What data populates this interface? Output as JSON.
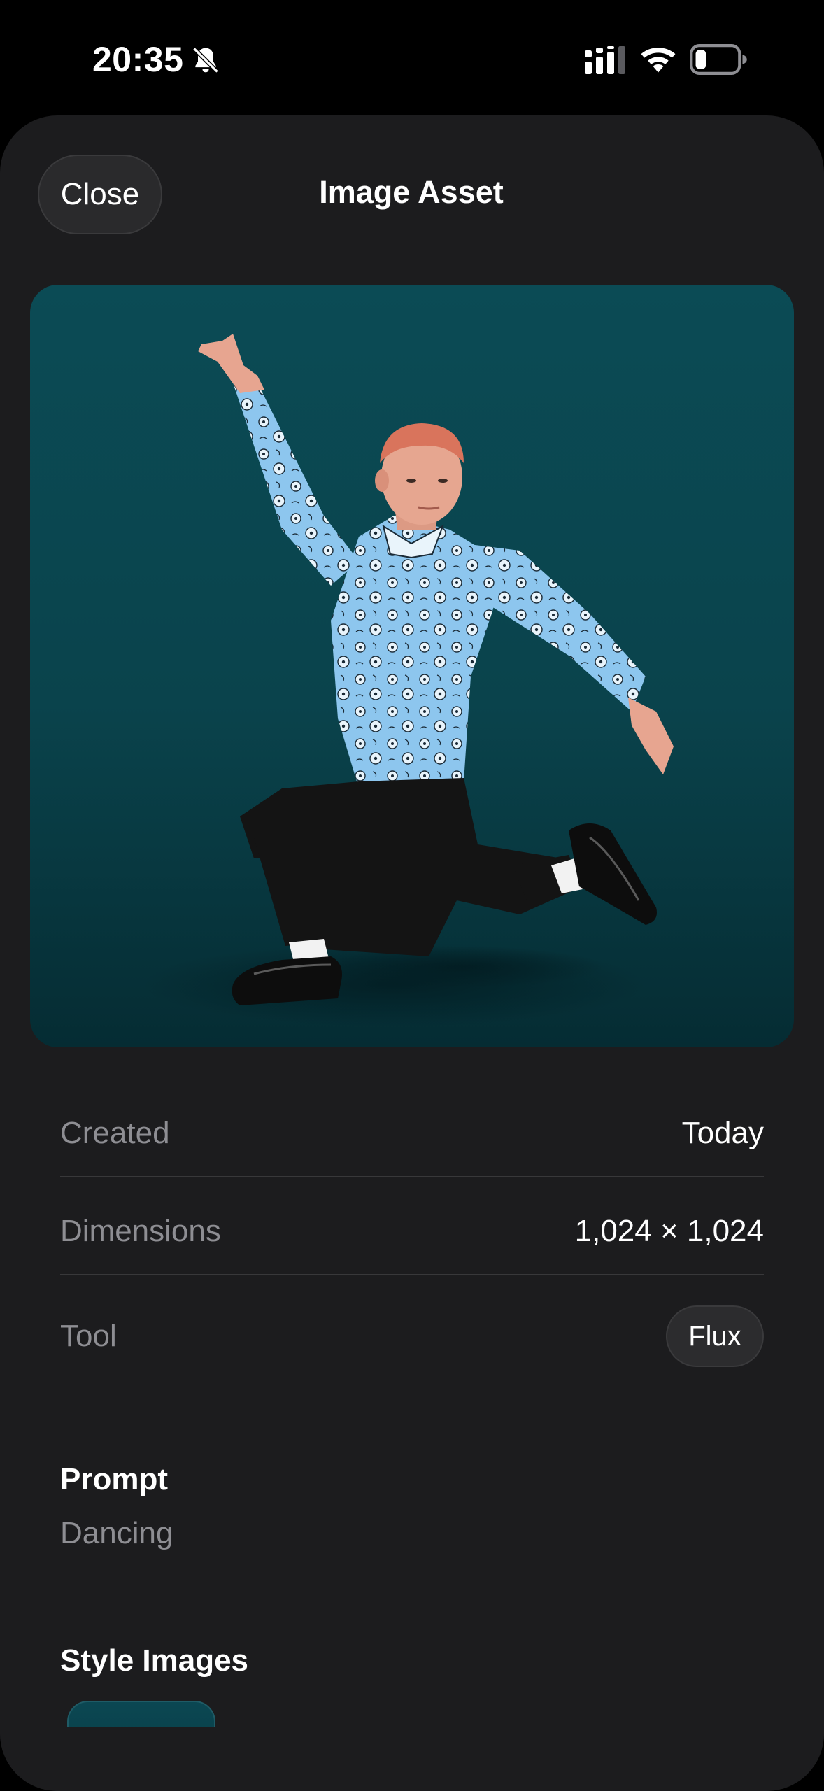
{
  "status_bar": {
    "time": "20:35",
    "icons": [
      "bell-slash-icon",
      "cellular-signal-icon",
      "wifi-icon",
      "battery-icon"
    ]
  },
  "sheet": {
    "close_label": "Close",
    "title": "Image Asset"
  },
  "details": {
    "created_label": "Created",
    "created_value": "Today",
    "dimensions_label": "Dimensions",
    "dimensions_value": "1,024 × 1,024",
    "tool_label": "Tool",
    "tool_value": "Flux"
  },
  "prompt": {
    "heading": "Prompt",
    "text": "Dancing"
  },
  "style_images": {
    "heading": "Style Images"
  },
  "colors": {
    "background": "#000000",
    "sheet": "#1c1c1e",
    "secondary_text": "#8e8e93",
    "image_backdrop": "#0b4a54"
  }
}
